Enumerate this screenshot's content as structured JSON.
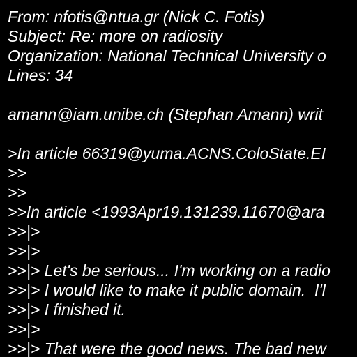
{
  "colors": {
    "background": "#000000",
    "text": "#ffffff"
  },
  "message": {
    "lines": [
      "From: nfotis@ntua.gr (Nick C. Fotis)",
      "Subject: Re: more on radiosity",
      "Organization: National Technical University o",
      "Lines: 34",
      "",
      "amann@iam.unibe.ch (Stephan Amann) writ",
      "",
      ">In article 66319@yuma.ACNS.ColoState.EI",
      ">>",
      ">>",
      ">>In article <1993Apr19.131239.11670@ara",
      ">>|>",
      ">>|>",
      ">>|> Let's be serious... I'm working on a radio",
      ">>|> I would like to make it public domain.  I'l",
      ">>|> I finished it.",
      ">>|>",
      ">>|> That were the good news. The bad new"
    ]
  }
}
